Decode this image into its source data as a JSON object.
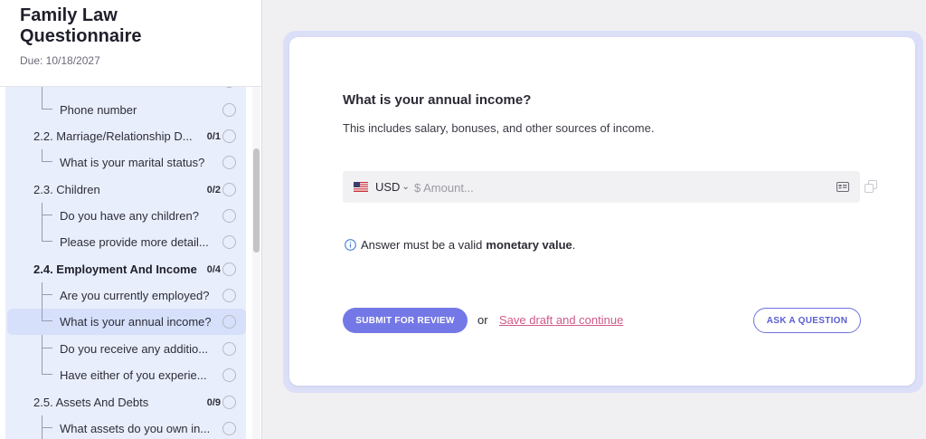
{
  "sidebar": {
    "title": "Family Law Questionnaire",
    "due": "Due: 10/18/2027",
    "items": [
      {
        "label": "Phone number"
      },
      {
        "label": "2.2. Marriage/Relationship D...",
        "count": "0/1"
      },
      {
        "label": "What is your marital status?"
      },
      {
        "label": "2.3. Children",
        "count": "0/2"
      },
      {
        "label": "Do you have any children?"
      },
      {
        "label": "Please provide more detail..."
      },
      {
        "label": "2.4. Employment And Income",
        "count": "0/4"
      },
      {
        "label": "Are you currently employed?"
      },
      {
        "label": "What is your annual income?"
      },
      {
        "label": "Do you receive any additio..."
      },
      {
        "label": "Have either of you experie..."
      },
      {
        "label": "2.5. Assets And Debts",
        "count": "0/9"
      },
      {
        "label": "What assets do you own in..."
      }
    ]
  },
  "question": {
    "title": "What is your annual income?",
    "description": "This includes salary, bonuses, and other sources of income.",
    "currency": "USD",
    "amount_placeholder": "$ Amount...",
    "hint_prefix": "Answer must be a valid",
    "hint_bold": "monetary value",
    "hint_suffix": "."
  },
  "actions": {
    "submit_label": "SUBMIT FOR REVIEW",
    "or_label": "or",
    "save_label": "Save draft and continue",
    "ask_label": "ASK A QUESTION"
  },
  "colors": {
    "accent": "#7478e6",
    "link": "#d05a8a",
    "active_item_bg": "#d6e0fa"
  }
}
